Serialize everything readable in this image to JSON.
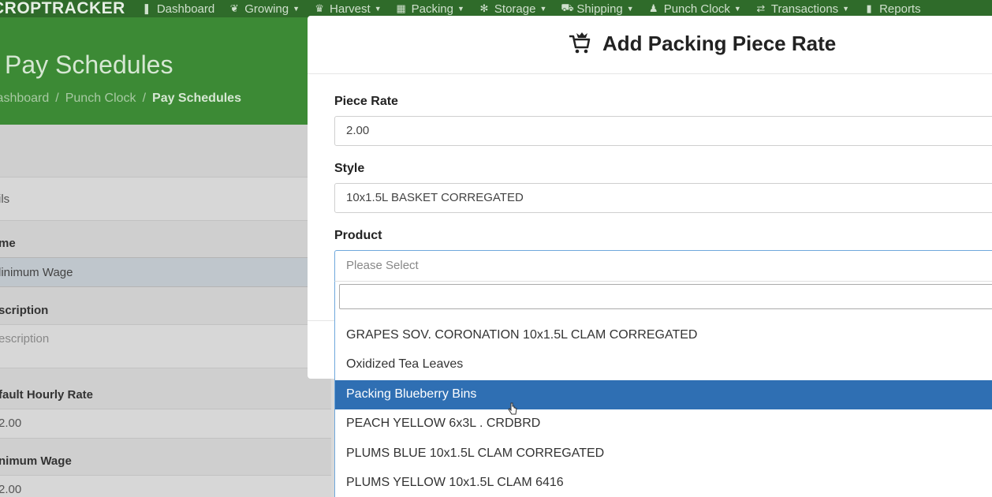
{
  "nav": {
    "brand": "CROPTRACKER",
    "items": [
      {
        "label": "Dashboard",
        "icon": "bookmark-icon",
        "glyph": "❚",
        "caret": false
      },
      {
        "label": "Growing",
        "icon": "leaf-icon",
        "glyph": "❦",
        "caret": true
      },
      {
        "label": "Harvest",
        "icon": "basket-icon",
        "glyph": "♛",
        "caret": true
      },
      {
        "label": "Packing",
        "icon": "boxes-icon",
        "glyph": "▦",
        "caret": true
      },
      {
        "label": "Storage",
        "icon": "snowflake-icon",
        "glyph": "✻",
        "caret": true
      },
      {
        "label": "Shipping",
        "icon": "truck-icon",
        "glyph": "⛟",
        "caret": true
      },
      {
        "label": "Punch Clock",
        "icon": "user-icon",
        "glyph": "♟",
        "caret": true
      },
      {
        "label": "Transactions",
        "icon": "exchange-icon",
        "glyph": "⇄",
        "caret": true
      },
      {
        "label": "Reports",
        "icon": "bar-chart-icon",
        "glyph": "▮",
        "caret": false
      }
    ],
    "caret_glyph": "▼"
  },
  "header": {
    "title": "Pay Schedules",
    "breadcrumb": [
      "Dashboard",
      "Punch Clock",
      "Pay Schedules"
    ],
    "separator": "/"
  },
  "background_form": {
    "section": "ils",
    "name_label": "me",
    "name_value": "linimum Wage",
    "description_label": "scription",
    "description_placeholder": "escription",
    "default_rate_label": "fault Hourly Rate",
    "default_rate_value": "2.00",
    "minimum_wage_label": "nimum Wage",
    "minimum_wage_value": "2.00"
  },
  "modal": {
    "title": "Add Packing Piece Rate",
    "title_icon": "cart-icon",
    "piece_rate_label": "Piece Rate",
    "piece_rate_value": "2.00",
    "style_label": "Style",
    "style_value": "10x1.5L BASKET CORREGATED",
    "product_label": "Product",
    "product_placeholder": "Please Select"
  },
  "dropdown": {
    "options": [
      "GRAPES SOV. CORONATION 10x1.5L CLAM CORREGATED",
      "Oxidized Tea Leaves",
      "Packing Blueberry Bins",
      "PEACH YELLOW 6x3L . CRDBRD",
      "PLUMS BLUE 10x1.5L CLAM CORREGATED",
      "PLUMS YELLOW 10x1.5L CLAM 6416"
    ],
    "highlighted_index": 2,
    "highlight_color": "#2f6fb3"
  }
}
